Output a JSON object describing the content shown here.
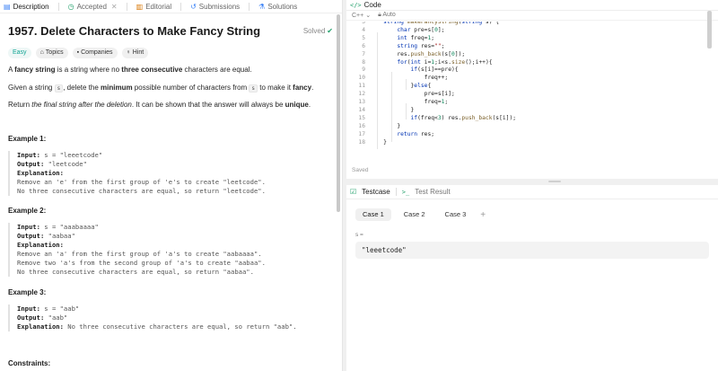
{
  "tabs": {
    "description": "Description",
    "accepted": "Accepted",
    "editorial": "Editorial",
    "submissions": "Submissions",
    "solutions": "Solutions"
  },
  "problem": {
    "title": "1957. Delete Characters to Make Fancy String",
    "status": "Solved",
    "chips": {
      "difficulty": "Easy",
      "topics": "Topics",
      "companies": "Companies",
      "hint": "Hint"
    },
    "p1": {
      "a": "A ",
      "b": "fancy string",
      "c": " is a string where no ",
      "d": "three consecutive",
      "e": " characters are equal."
    },
    "p2": {
      "a": "Given a string ",
      "s1": "s",
      "b": ", delete the ",
      "c": "minimum",
      "d": " possible number of characters from ",
      "s2": "s",
      "e": " to make it ",
      "f": "fancy",
      "g": "."
    },
    "p3": {
      "a": "Return ",
      "b": "the final string after the deletion",
      "c": ". It can be shown that the answer will always be ",
      "d": "unique",
      "e": "."
    },
    "examples": [
      {
        "title": "Example 1:",
        "input": "s = \"leeetcode\"",
        "output": "\"leetcode\"",
        "lines": [
          "Remove an 'e' from the first group of 'e's to create \"leetcode\".",
          "No three consecutive characters are equal, so return \"leetcode\"."
        ]
      },
      {
        "title": "Example 2:",
        "input": "s = \"aaabaaaa\"",
        "output": "\"aabaa\"",
        "lines": [
          "Remove an 'a' from the first group of 'a's to create \"aabaaaa\".",
          "Remove two 'a's from the second group of 'a's to create \"aabaa\".",
          "No three consecutive characters are equal, so return \"aabaa\"."
        ]
      },
      {
        "title": "Example 3:",
        "input": "s = \"aab\"",
        "output": "\"aab\"",
        "explanation": "No three consecutive characters are equal, so return \"aab\"."
      }
    ],
    "labels": {
      "input": "Input:",
      "output": "Output:",
      "explanation": "Explanation:"
    },
    "constraints": "Constraints:"
  },
  "code": {
    "header": "Code",
    "language": "C++",
    "mode": "Auto",
    "saved": "Saved",
    "lines": [
      {
        "n": "3",
        "t": "    string makeFancyString(string s) {"
      },
      {
        "n": "4",
        "t": "        char pre=s[0];"
      },
      {
        "n": "5",
        "t": "        int freq=1;"
      },
      {
        "n": "6",
        "t": "        string res=\"\";"
      },
      {
        "n": "7",
        "t": "        res.push_back(s[0]);"
      },
      {
        "n": "8",
        "t": "        for(int i=1;i<s.size();i++){"
      },
      {
        "n": "9",
        "t": "            if(s[i]==pre){"
      },
      {
        "n": "10",
        "t": "                freq++;"
      },
      {
        "n": "11",
        "t": "            }else{"
      },
      {
        "n": "12",
        "t": "                pre=s[i];"
      },
      {
        "n": "13",
        "t": "                freq=1;"
      },
      {
        "n": "14",
        "t": "            }"
      },
      {
        "n": "15",
        "t": "            if(freq<3) res.push_back(s[i]);"
      },
      {
        "n": "16",
        "t": "        }"
      },
      {
        "n": "17",
        "t": "        return res;"
      },
      {
        "n": "18",
        "t": "    }"
      }
    ]
  },
  "testcase": {
    "tab": "Testcase",
    "result_tab": "Test Result",
    "cases": [
      "Case 1",
      "Case 2",
      "Case 3"
    ],
    "add": "+",
    "var_label": "s =",
    "var_value": "\"leeetcode\""
  },
  "colors": {
    "accent_green": "#22a06b",
    "easy": "#12a594",
    "keyword": "#0033b3",
    "string": "#a31515"
  }
}
